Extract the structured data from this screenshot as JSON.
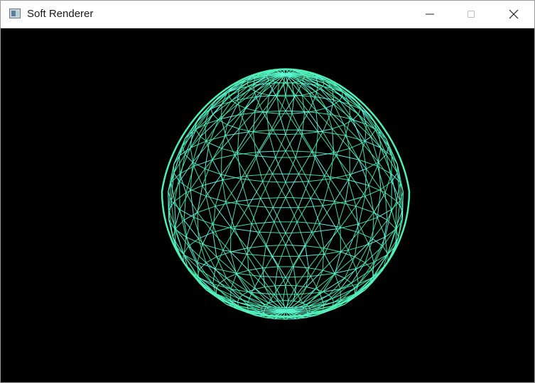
{
  "window": {
    "title": "Soft Renderer",
    "icons": {
      "app": "window-app-icon",
      "minimize": "minimize-icon",
      "maximize": "maximize-icon",
      "close": "close-icon"
    }
  },
  "viewport": {
    "background": "#000000",
    "wire_color": "#4ef0b4",
    "wire_highlight": "#6cfff0",
    "mesh": "wireframe-mesh"
  }
}
